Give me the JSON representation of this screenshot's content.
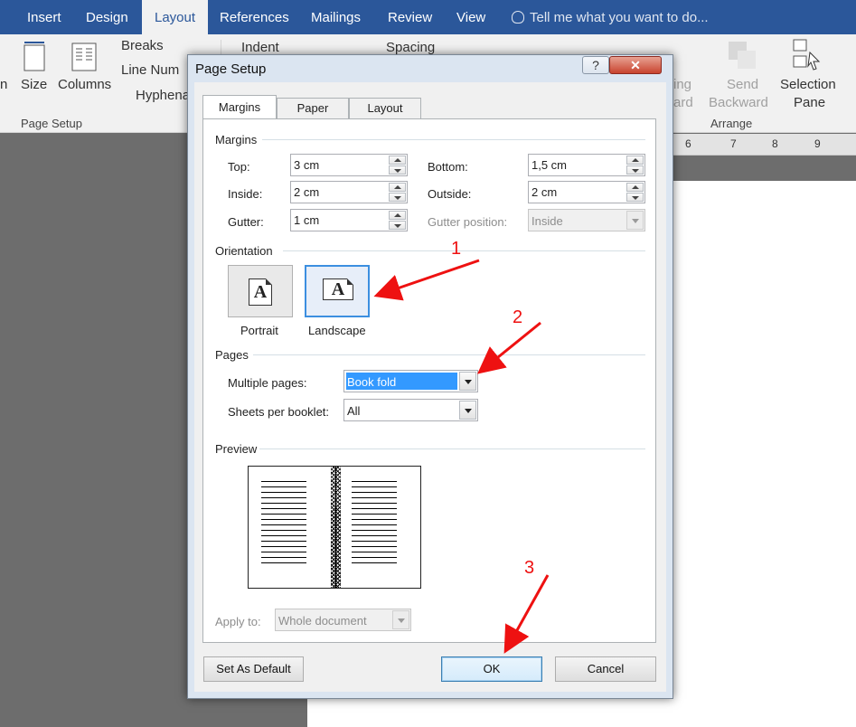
{
  "word": {
    "tabs": [
      "Insert",
      "Design",
      "Layout",
      "References",
      "Mailings",
      "Review",
      "View"
    ],
    "active_tab": "Layout",
    "tell_me": "Tell me what you want to do...",
    "ribbon": {
      "size": "Size",
      "columns": "Columns",
      "breaks": "Breaks",
      "line_numbers": "Line Num",
      "hyphenation": "Hyphena",
      "left_cut": "n",
      "page_setup_group": "Page Setup",
      "indent": "Indent",
      "spacing": "Spacing",
      "bring_forward_cut": "ing",
      "bring_forward_cut2": "ard",
      "send": "Send",
      "send_backward": "Backward",
      "selection": "Selection",
      "pane": "Pane",
      "arrange_group": "Arrange"
    },
    "ruler": [
      "6",
      "7",
      "8",
      "9"
    ]
  },
  "dialog": {
    "title": "Page Setup",
    "help": "?",
    "close": "✕",
    "tabs": [
      "Margins",
      "Paper",
      "Layout"
    ],
    "selected_tab": "Margins",
    "margins": {
      "heading": "Margins",
      "top_label": "Top:",
      "top": "3 cm",
      "bottom_label": "Bottom:",
      "bottom": "1,5 cm",
      "inside_label": "Inside:",
      "inside": "2 cm",
      "outside_label": "Outside:",
      "outside": "2 cm",
      "gutter_label": "Gutter:",
      "gutter": "1 cm",
      "gutter_pos_label": "Gutter position:",
      "gutter_pos": "Inside"
    },
    "orientation": {
      "heading": "Orientation",
      "portrait": "Portrait",
      "landscape": "Landscape",
      "icon_letter": "A",
      "selected": "Landscape"
    },
    "pages": {
      "heading": "Pages",
      "multiple_label": "Multiple pages:",
      "multiple_value": "Book fold",
      "sheets_label": "Sheets per booklet:",
      "sheets_value": "All"
    },
    "preview": {
      "heading": "Preview"
    },
    "apply": {
      "label": "Apply to:",
      "value": "Whole document"
    },
    "buttons": {
      "set_default": "Set As Default",
      "ok": "OK",
      "cancel": "Cancel"
    }
  },
  "annotations": {
    "numbers": [
      "1",
      "2",
      "3"
    ],
    "color": "#e11111"
  },
  "colors": {
    "word_blue": "#2b579a",
    "selection_blue": "#3399ff"
  }
}
